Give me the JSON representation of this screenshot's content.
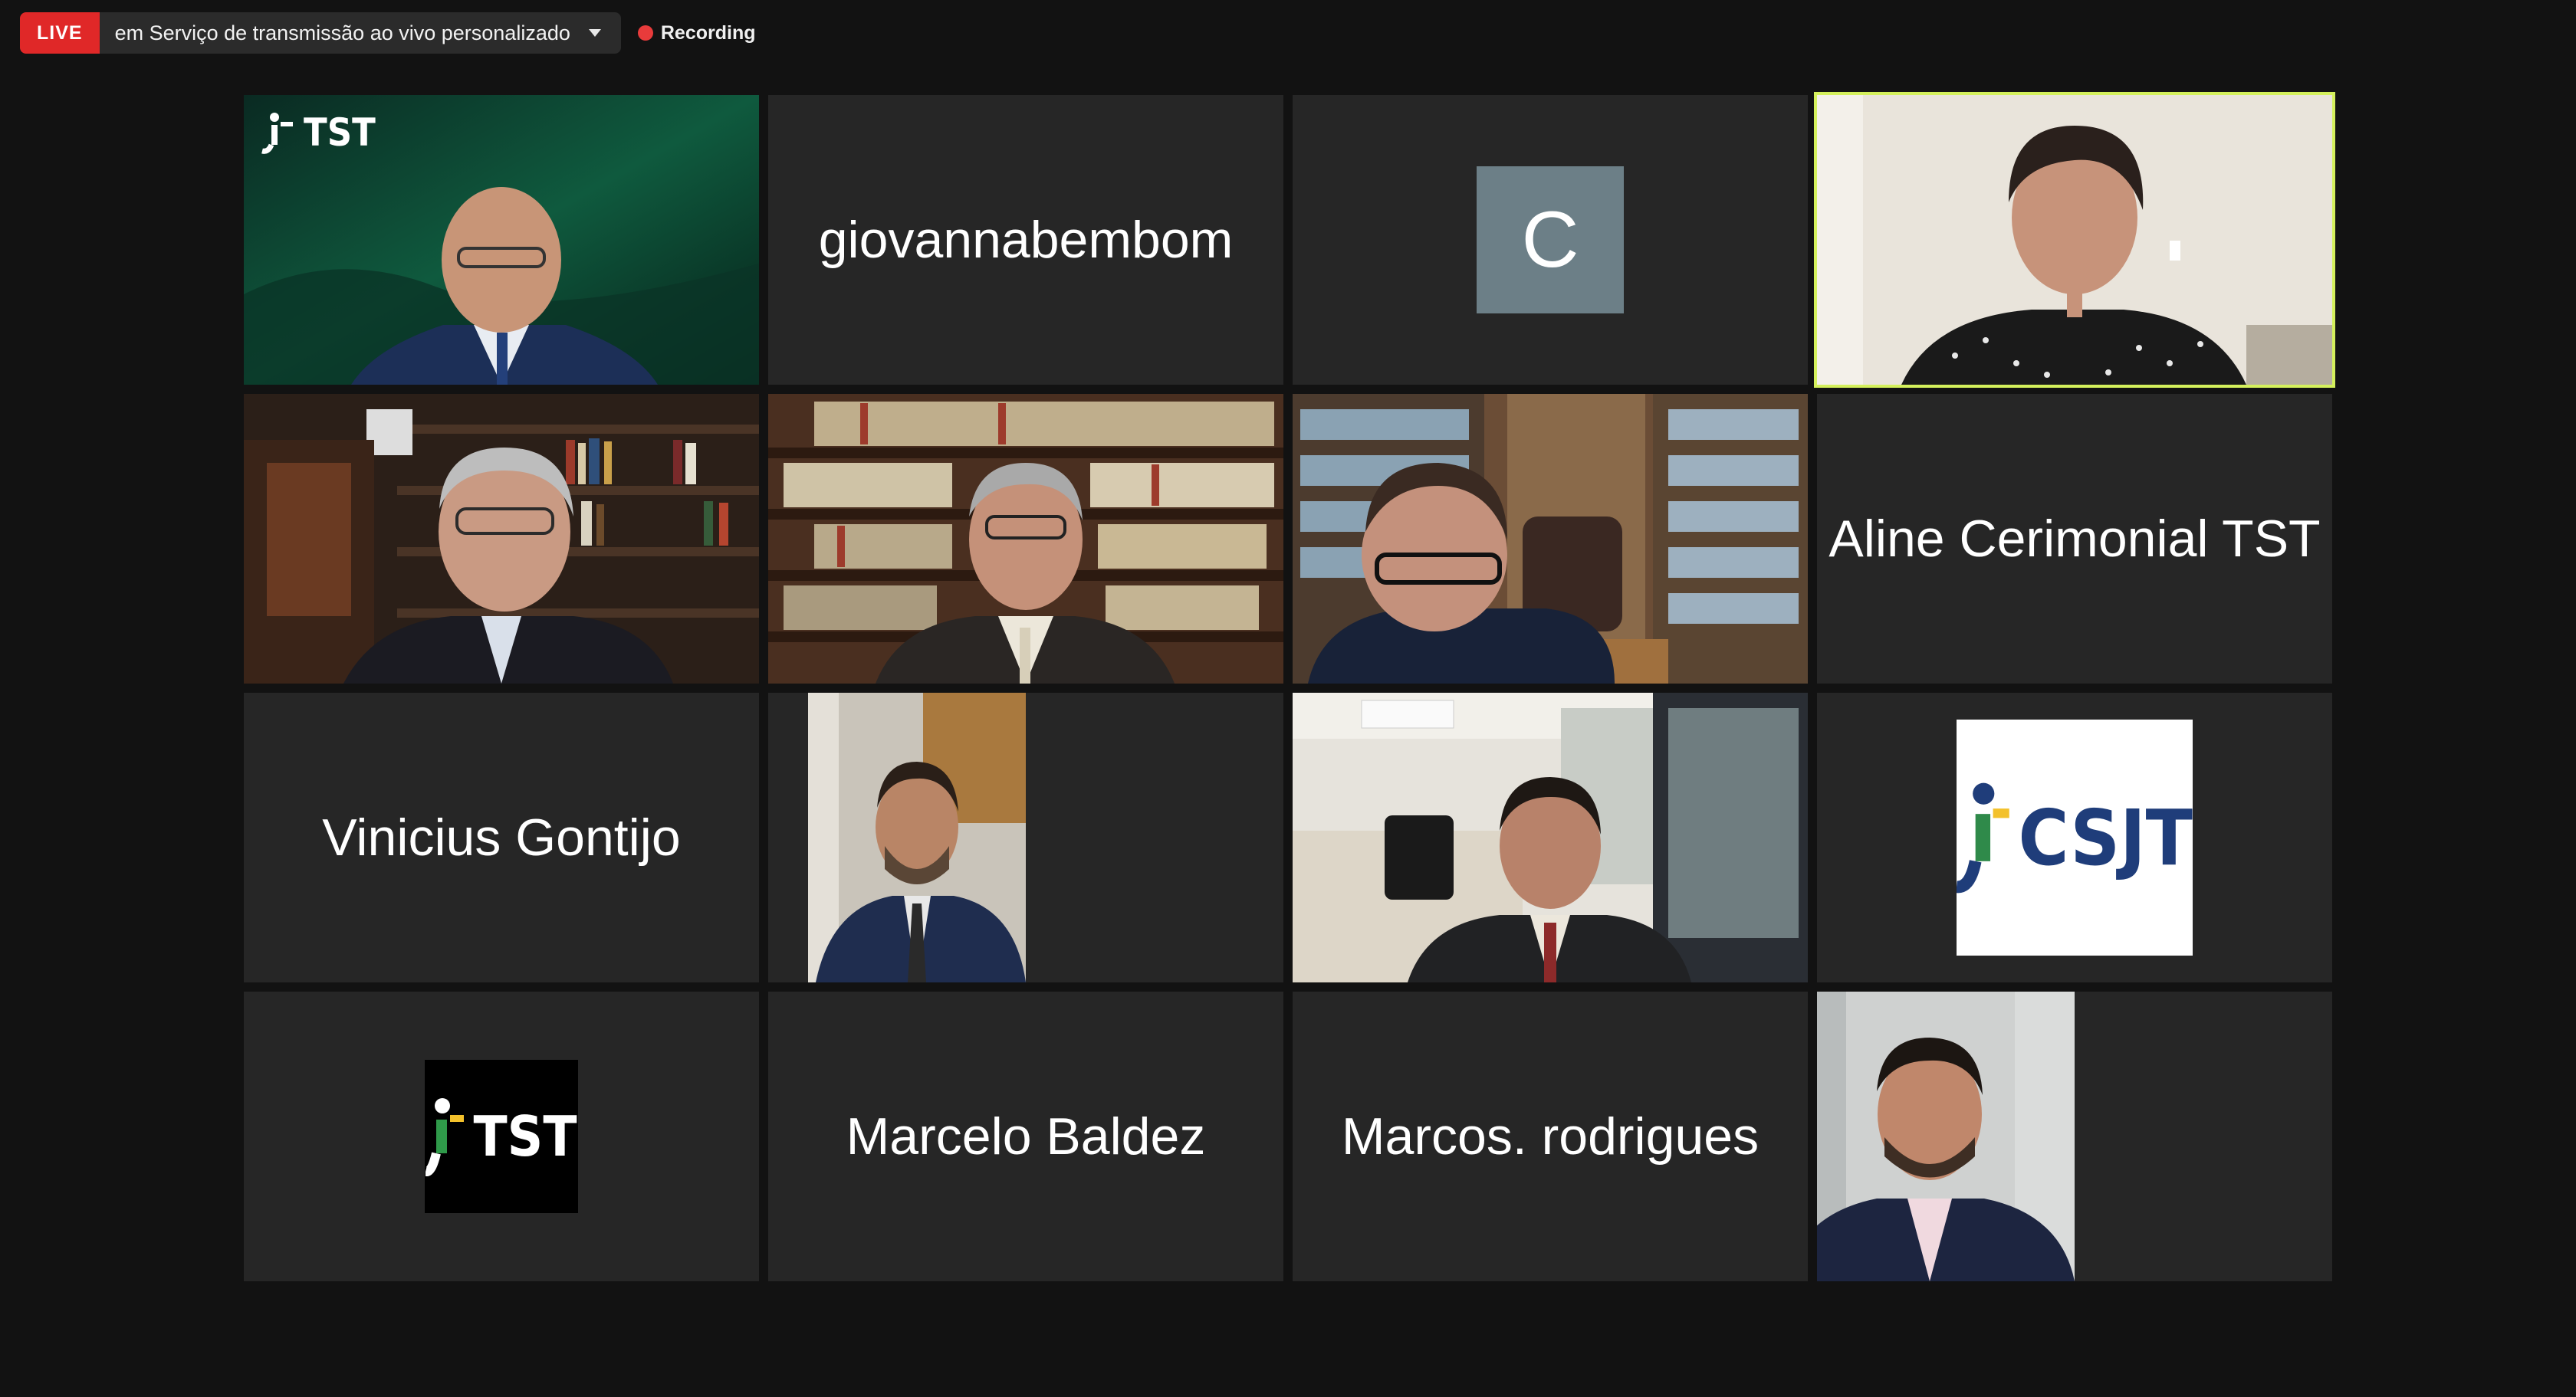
{
  "topbar": {
    "live_label": "LIVE",
    "stream_target": "em Serviço de transmissão ao vivo personalizado",
    "recording_label": "Recording"
  },
  "colors": {
    "live_red": "#e02828",
    "speaker_highlight": "#d4f05c",
    "tile_bg": "#262626",
    "avatar_bg": "#6c7f87"
  },
  "tiles": [
    {
      "type": "video",
      "overlay": "TST"
    },
    {
      "type": "name",
      "name": "giovannabembom"
    },
    {
      "type": "avatar",
      "letter": "C"
    },
    {
      "type": "video",
      "speaking": true
    },
    {
      "type": "video"
    },
    {
      "type": "video"
    },
    {
      "type": "video"
    },
    {
      "type": "name",
      "name": "Aline Cerimonial TST"
    },
    {
      "type": "name",
      "name": "Vinicius Gontijo"
    },
    {
      "type": "video"
    },
    {
      "type": "video"
    },
    {
      "type": "logo",
      "logo": "CSJT"
    },
    {
      "type": "logo",
      "logo": "TST"
    },
    {
      "type": "name",
      "name": "Marcelo Baldez"
    },
    {
      "type": "name",
      "name": "Marcos. rodrigues"
    },
    {
      "type": "video"
    }
  ]
}
